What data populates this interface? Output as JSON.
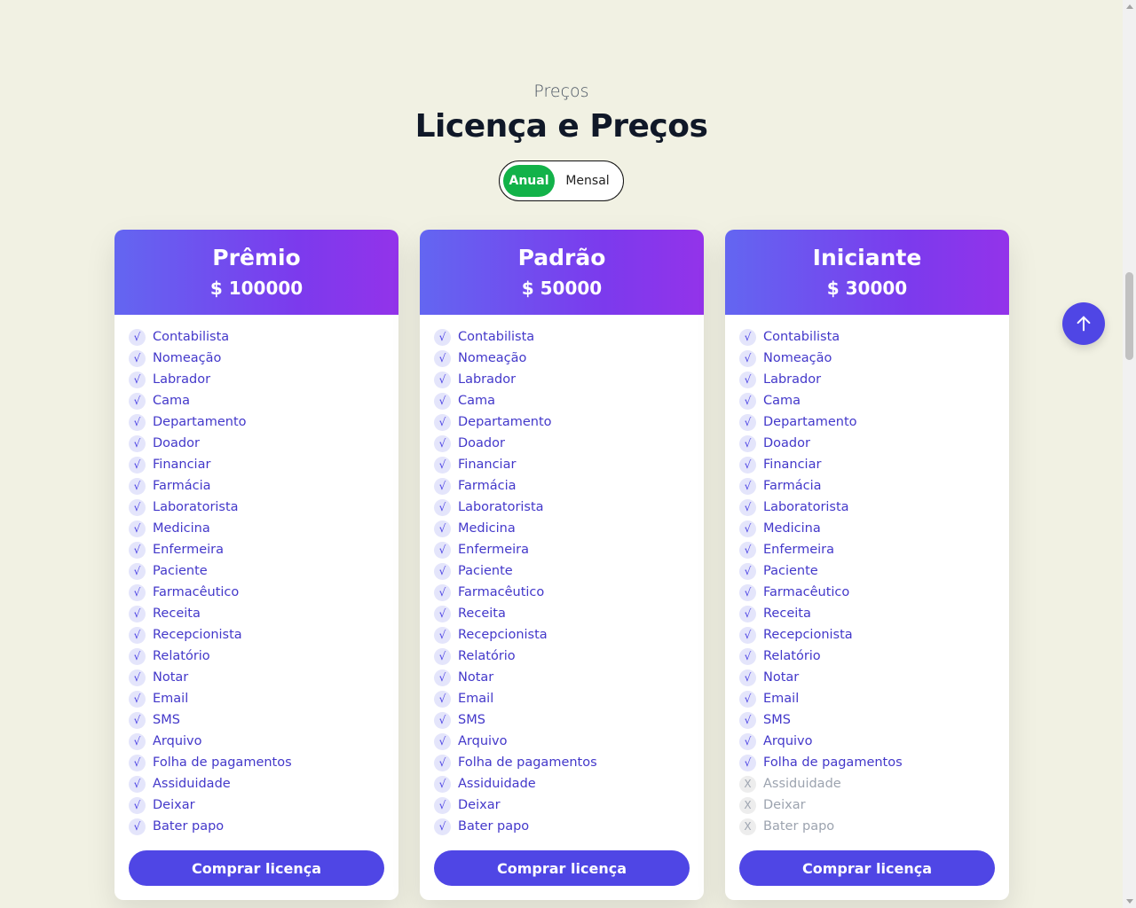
{
  "section": {
    "eyebrow": "Preços",
    "title": "Licença e Preços"
  },
  "toggle": {
    "annual_label": "Anual",
    "monthly_label": "Mensal",
    "selected": "Anual"
  },
  "colors": {
    "background": "#f1f1e3",
    "accent": "#4f46e5",
    "header_gradient_start": "#6366f1",
    "header_gradient_end": "#9333ea",
    "toggle_active": "#12b249"
  },
  "plans": [
    {
      "name": "Prêmio",
      "price": "$ 100000",
      "button_label": "Comprar licença",
      "features": [
        {
          "label": "Contabilista",
          "icon": "√",
          "included": true
        },
        {
          "label": "Nomeação",
          "icon": "√",
          "included": true
        },
        {
          "label": "Labrador",
          "icon": "√",
          "included": true
        },
        {
          "label": "Cama",
          "icon": "√",
          "included": true
        },
        {
          "label": "Departamento",
          "icon": "√",
          "included": true
        },
        {
          "label": "Doador",
          "icon": "√",
          "included": true
        },
        {
          "label": "Financiar",
          "icon": "√",
          "included": true
        },
        {
          "label": "Farmácia",
          "icon": "√",
          "included": true
        },
        {
          "label": "Laboratorista",
          "icon": "√",
          "included": true
        },
        {
          "label": "Medicina",
          "icon": "√",
          "included": true
        },
        {
          "label": "Enfermeira",
          "icon": "√",
          "included": true
        },
        {
          "label": "Paciente",
          "icon": "√",
          "included": true
        },
        {
          "label": "Farmacêutico",
          "icon": "√",
          "included": true
        },
        {
          "label": "Receita",
          "icon": "√",
          "included": true
        },
        {
          "label": "Recepcionista",
          "icon": "√",
          "included": true
        },
        {
          "label": "Relatório",
          "icon": "√",
          "included": true
        },
        {
          "label": "Notar",
          "icon": "√",
          "included": true
        },
        {
          "label": "Email",
          "icon": "√",
          "included": true
        },
        {
          "label": "SMS",
          "icon": "√",
          "included": true
        },
        {
          "label": "Arquivo",
          "icon": "√",
          "included": true
        },
        {
          "label": "Folha de pagamentos",
          "icon": "√",
          "included": true
        },
        {
          "label": "Assiduidade",
          "icon": "√",
          "included": true
        },
        {
          "label": "Deixar",
          "icon": "√",
          "included": true
        },
        {
          "label": "Bater papo",
          "icon": "√",
          "included": true
        }
      ]
    },
    {
      "name": "Padrão",
      "price": "$ 50000",
      "button_label": "Comprar licença",
      "features": [
        {
          "label": "Contabilista",
          "icon": "√",
          "included": true
        },
        {
          "label": "Nomeação",
          "icon": "√",
          "included": true
        },
        {
          "label": "Labrador",
          "icon": "√",
          "included": true
        },
        {
          "label": "Cama",
          "icon": "√",
          "included": true
        },
        {
          "label": "Departamento",
          "icon": "√",
          "included": true
        },
        {
          "label": "Doador",
          "icon": "√",
          "included": true
        },
        {
          "label": "Financiar",
          "icon": "√",
          "included": true
        },
        {
          "label": "Farmácia",
          "icon": "√",
          "included": true
        },
        {
          "label": "Laboratorista",
          "icon": "√",
          "included": true
        },
        {
          "label": "Medicina",
          "icon": "√",
          "included": true
        },
        {
          "label": "Enfermeira",
          "icon": "√",
          "included": true
        },
        {
          "label": "Paciente",
          "icon": "√",
          "included": true
        },
        {
          "label": "Farmacêutico",
          "icon": "√",
          "included": true
        },
        {
          "label": "Receita",
          "icon": "√",
          "included": true
        },
        {
          "label": "Recepcionista",
          "icon": "√",
          "included": true
        },
        {
          "label": "Relatório",
          "icon": "√",
          "included": true
        },
        {
          "label": "Notar",
          "icon": "√",
          "included": true
        },
        {
          "label": "Email",
          "icon": "√",
          "included": true
        },
        {
          "label": "SMS",
          "icon": "√",
          "included": true
        },
        {
          "label": "Arquivo",
          "icon": "√",
          "included": true
        },
        {
          "label": "Folha de pagamentos",
          "icon": "√",
          "included": true
        },
        {
          "label": "Assiduidade",
          "icon": "√",
          "included": true
        },
        {
          "label": "Deixar",
          "icon": "√",
          "included": true
        },
        {
          "label": "Bater papo",
          "icon": "√",
          "included": true
        }
      ]
    },
    {
      "name": "Iniciante",
      "price": "$ 30000",
      "button_label": "Comprar licença",
      "features": [
        {
          "label": "Contabilista",
          "icon": "√",
          "included": true
        },
        {
          "label": "Nomeação",
          "icon": "√",
          "included": true
        },
        {
          "label": "Labrador",
          "icon": "√",
          "included": true
        },
        {
          "label": "Cama",
          "icon": "√",
          "included": true
        },
        {
          "label": "Departamento",
          "icon": "√",
          "included": true
        },
        {
          "label": "Doador",
          "icon": "√",
          "included": true
        },
        {
          "label": "Financiar",
          "icon": "√",
          "included": true
        },
        {
          "label": "Farmácia",
          "icon": "√",
          "included": true
        },
        {
          "label": "Laboratorista",
          "icon": "√",
          "included": true
        },
        {
          "label": "Medicina",
          "icon": "√",
          "included": true
        },
        {
          "label": "Enfermeira",
          "icon": "√",
          "included": true
        },
        {
          "label": "Paciente",
          "icon": "√",
          "included": true
        },
        {
          "label": "Farmacêutico",
          "icon": "√",
          "included": true
        },
        {
          "label": "Receita",
          "icon": "√",
          "included": true
        },
        {
          "label": "Recepcionista",
          "icon": "√",
          "included": true
        },
        {
          "label": "Relatório",
          "icon": "√",
          "included": true
        },
        {
          "label": "Notar",
          "icon": "√",
          "included": true
        },
        {
          "label": "Email",
          "icon": "√",
          "included": true
        },
        {
          "label": "SMS",
          "icon": "√",
          "included": true
        },
        {
          "label": "Arquivo",
          "icon": "√",
          "included": true
        },
        {
          "label": "Folha de pagamentos",
          "icon": "√",
          "included": true
        },
        {
          "label": "Assiduidade",
          "icon": "X",
          "included": false
        },
        {
          "label": "Deixar",
          "icon": "X",
          "included": false
        },
        {
          "label": "Bater papo",
          "icon": "X",
          "included": false
        }
      ]
    }
  ],
  "icons": {
    "scroll_top": "arrow-up-icon"
  }
}
